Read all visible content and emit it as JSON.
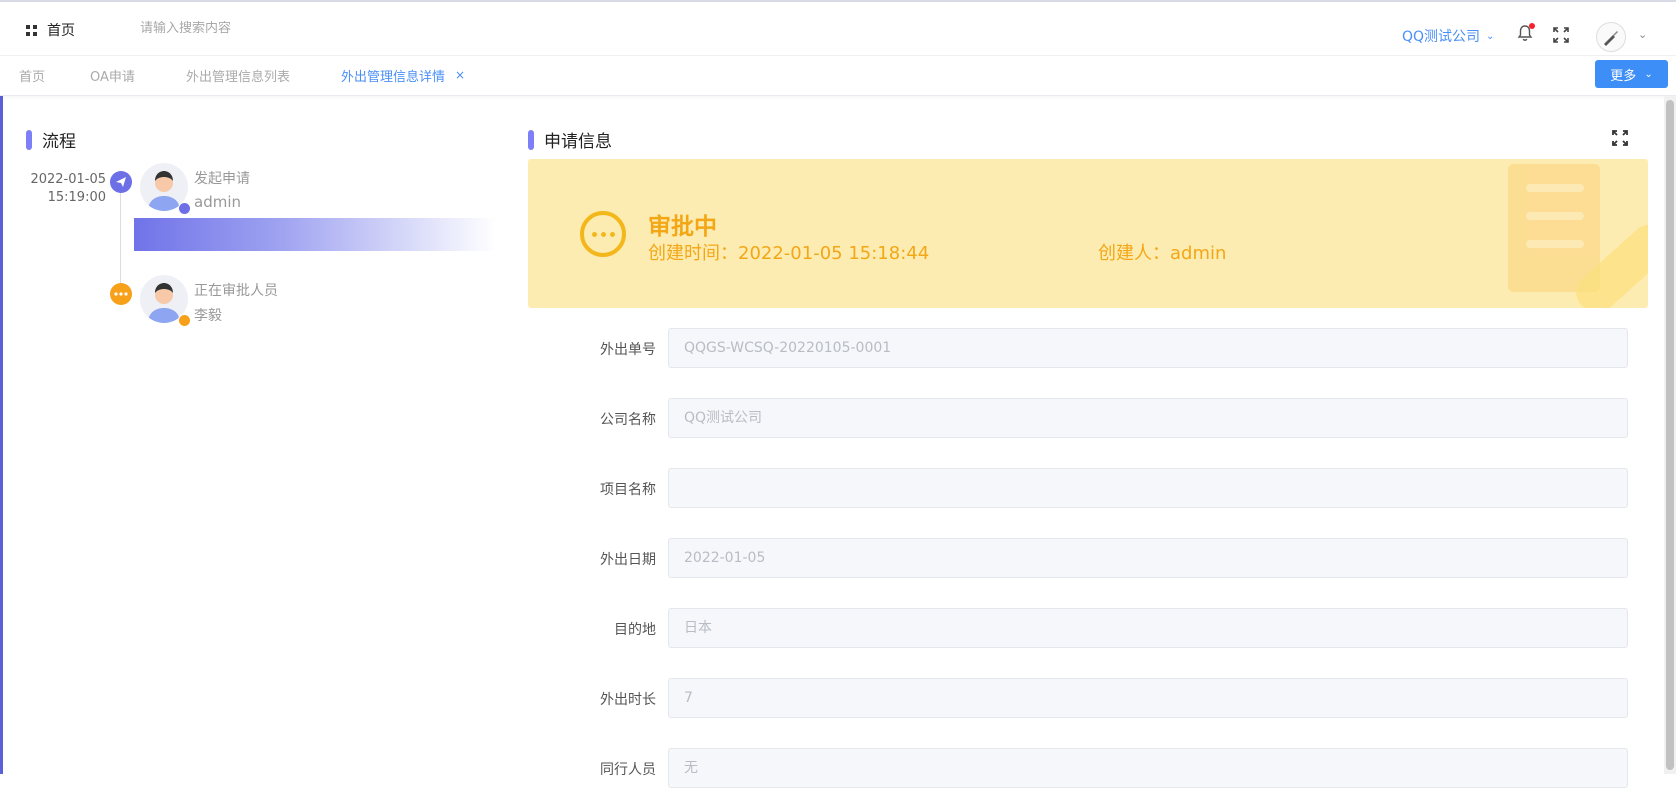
{
  "header": {
    "home_label": "首页",
    "search_placeholder": "请输入搜索内容",
    "company": "QQ测试公司"
  },
  "tabs": [
    {
      "label": "首页"
    },
    {
      "label": "OA申请"
    },
    {
      "label": "外出管理信息列表"
    },
    {
      "label": "外出管理信息详情"
    }
  ],
  "more_button": "更多",
  "process": {
    "title": "流程",
    "steps": [
      {
        "date": "2022-01-05",
        "time": "15:19:00",
        "action": "发起申请",
        "person": "admin",
        "status_color": "#6c6fe6"
      },
      {
        "action": "正在审批人员",
        "person": "李毅",
        "status_color": "#f7a01a"
      }
    ]
  },
  "apply": {
    "title": "申请信息",
    "status": "审批中",
    "created_time": "创建时间：2022-01-05 15:18:44",
    "creator": "创建人：admin",
    "status_color": "#f3a716"
  },
  "form": {
    "fields": [
      {
        "label": "外出单号",
        "value": "QQGS-WCSQ-20220105-0001"
      },
      {
        "label": "公司名称",
        "value": "QQ测试公司"
      },
      {
        "label": "项目名称",
        "value": ""
      },
      {
        "label": "外出日期",
        "value": "2022-01-05"
      },
      {
        "label": "目的地",
        "value": "日本"
      },
      {
        "label": "外出时长",
        "value": "7"
      },
      {
        "label": "同行人员",
        "value": "无"
      }
    ]
  },
  "colors": {
    "accent": "#4a8ff7",
    "primary_button": "#3e8ef7",
    "process_bar": "#7c7ff5"
  }
}
